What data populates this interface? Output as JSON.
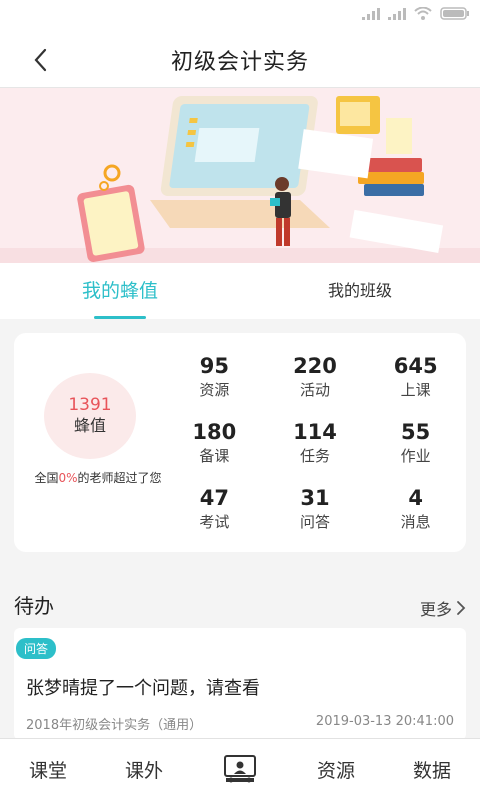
{
  "header": {
    "title": "初级会计实务"
  },
  "tabs": [
    {
      "label": "我的蜂值",
      "active": true
    },
    {
      "label": "我的班级",
      "active": false
    }
  ],
  "score": {
    "value": "1391",
    "label": "蜂值",
    "rank_prefix": "全国",
    "rank_percent": "0%",
    "rank_suffix": "的老师超过了您"
  },
  "stats": [
    {
      "value": "95",
      "label": "资源"
    },
    {
      "value": "220",
      "label": "活动"
    },
    {
      "value": "645",
      "label": "上课"
    },
    {
      "value": "180",
      "label": "备课"
    },
    {
      "value": "114",
      "label": "任务"
    },
    {
      "value": "55",
      "label": "作业"
    },
    {
      "value": "47",
      "label": "考试"
    },
    {
      "value": "31",
      "label": "问答"
    },
    {
      "value": "4",
      "label": "消息"
    }
  ],
  "todo": {
    "title": "待办",
    "more": "更多",
    "items": [
      {
        "badge": "问答",
        "text": "张梦晴提了一个问题，请查看",
        "course": "2018年初级会计实务（通用）",
        "time": "2019-03-13 20:41:00"
      }
    ]
  },
  "bottom_nav": [
    {
      "label": "课堂"
    },
    {
      "label": "课外"
    },
    {
      "label": "",
      "icon": "classroom-icon"
    },
    {
      "label": "资源"
    },
    {
      "label": "数据"
    }
  ],
  "colors": {
    "accent": "#2dbfc9",
    "highlight": "#e8545a",
    "banner_bg": "#fcecee"
  }
}
